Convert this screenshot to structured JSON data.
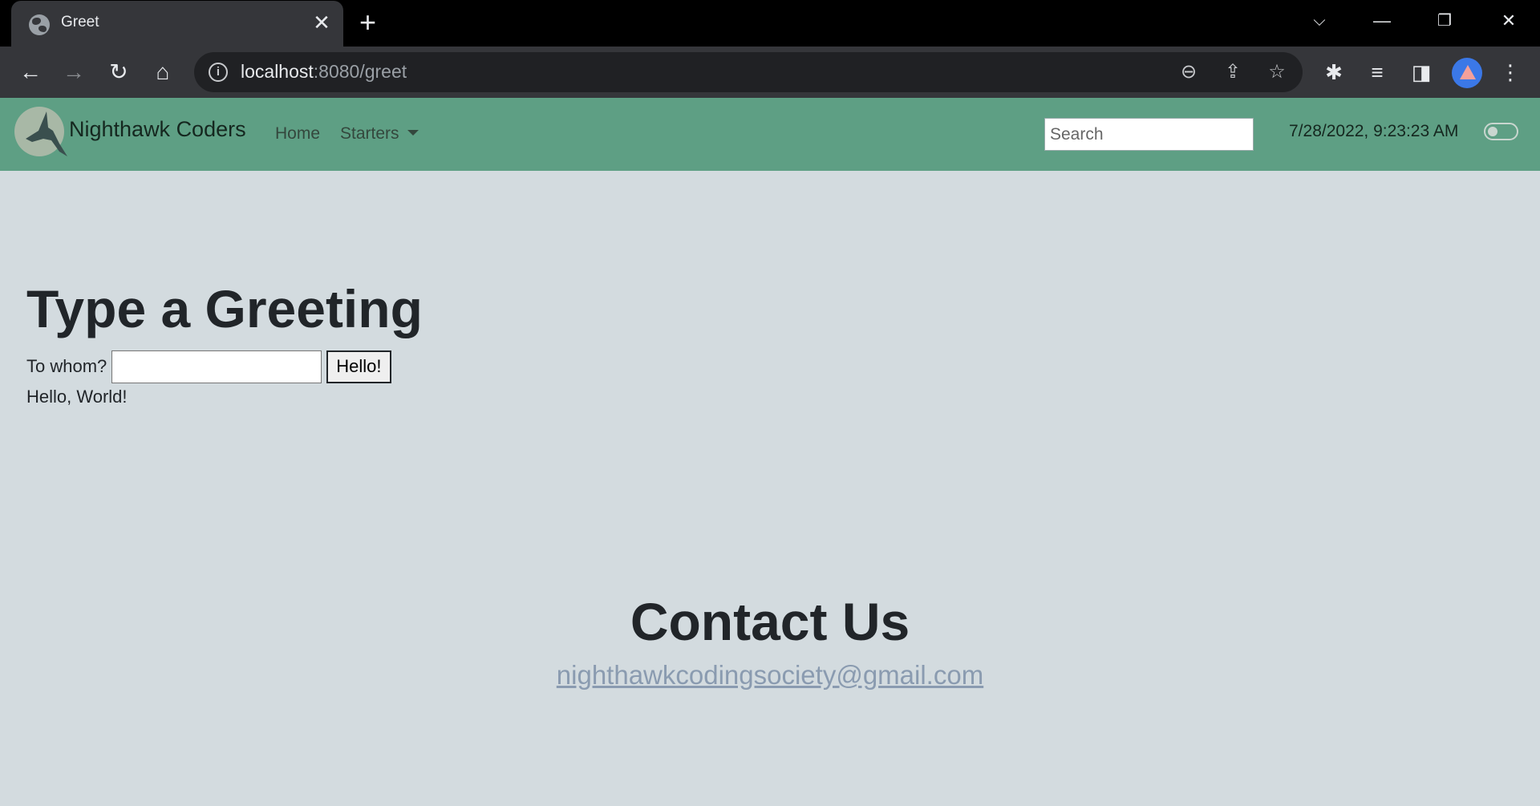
{
  "browser": {
    "tab_title": "Greet",
    "url_host": "localhost",
    "url_path": ":8080/greet",
    "icons": {
      "globe": "globe-icon",
      "close": "close-icon",
      "new_tab": "plus-icon",
      "back": "back-arrow-icon",
      "forward": "forward-arrow-icon",
      "reload": "reload-icon",
      "home": "home-icon",
      "zoom": "zoom-out-icon",
      "share": "share-icon",
      "bookmark": "star-icon",
      "extensions": "puzzle-icon",
      "media": "media-queue-icon",
      "sidepanel": "side-panel-icon",
      "menu": "kebab-menu-icon"
    }
  },
  "navbar": {
    "brand": "Nighthawk Coders",
    "links": [
      {
        "label": "Home"
      },
      {
        "label": "Starters"
      }
    ],
    "search_placeholder": "Search",
    "clock": "7/28/2022, 9:23:23 AM",
    "colors": {
      "background": "#5e9f84"
    }
  },
  "main": {
    "title": "Type a Greeting",
    "form": {
      "label": "To whom?",
      "input_value": "",
      "button_label": "Hello!"
    },
    "output": "Hello, World!"
  },
  "footer": {
    "title": "Contact Us",
    "email": "nighthawkcodingsociety@gmail.com"
  }
}
